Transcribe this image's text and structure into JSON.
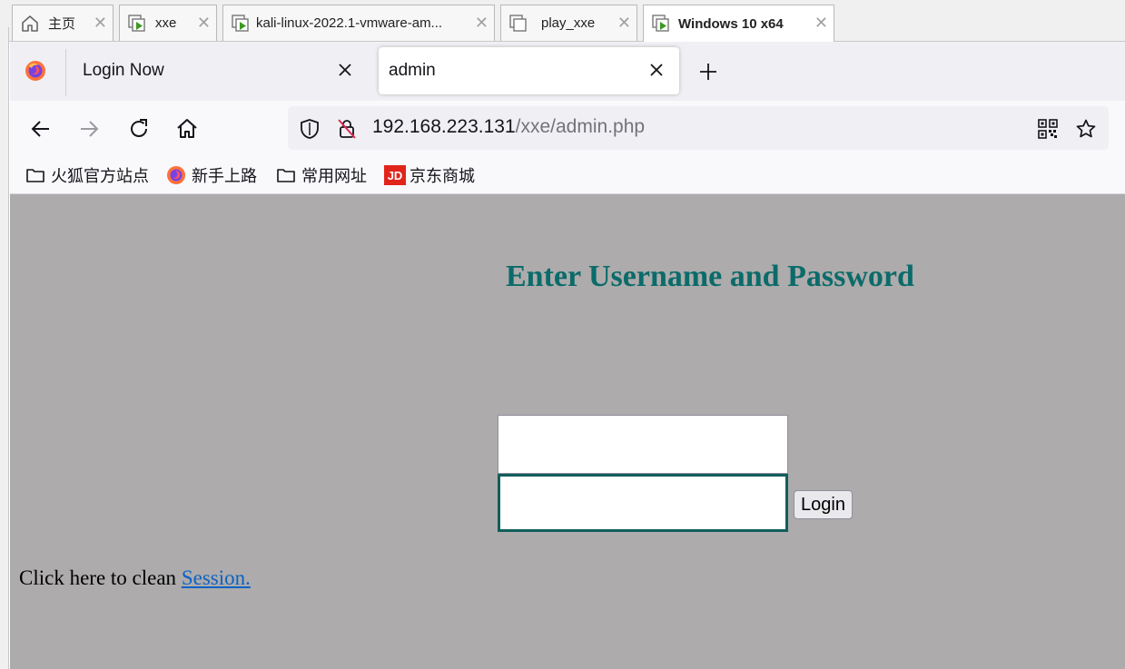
{
  "vm_tabs": [
    {
      "label": "主页",
      "icon": "home-icon"
    },
    {
      "label": "xxe",
      "icon": "vm-icon"
    },
    {
      "label": "kali-linux-2022.1-vmware-am...",
      "icon": "vm-icon"
    },
    {
      "label": "play_xxe",
      "icon": "vm-copy-icon"
    },
    {
      "label": "Windows 10 x64",
      "icon": "vm-icon",
      "active": true
    }
  ],
  "browser": {
    "tabs": [
      {
        "label": "Login Now",
        "active": false
      },
      {
        "label": "admin",
        "active": true
      }
    ],
    "url": {
      "host": "192.168.223.131",
      "path": "/xxe/admin.php"
    },
    "bookmarks": [
      {
        "label": "火狐官方站点",
        "icon": "folder-icon"
      },
      {
        "label": "新手上路",
        "icon": "firefox-icon"
      },
      {
        "label": "常用网址",
        "icon": "folder-icon"
      },
      {
        "label": "京东商城",
        "icon": "jd-icon"
      }
    ]
  },
  "page": {
    "heading": "Enter Username and Password",
    "username_value": "",
    "password_value": "",
    "login_label": "Login",
    "session_prefix": "Click here to clean ",
    "session_link": "Session."
  },
  "colors": {
    "page_bg": "#adabab",
    "heading": "#0b6b6a",
    "link": "#0b62c4",
    "focus_border": "#115e5c"
  }
}
